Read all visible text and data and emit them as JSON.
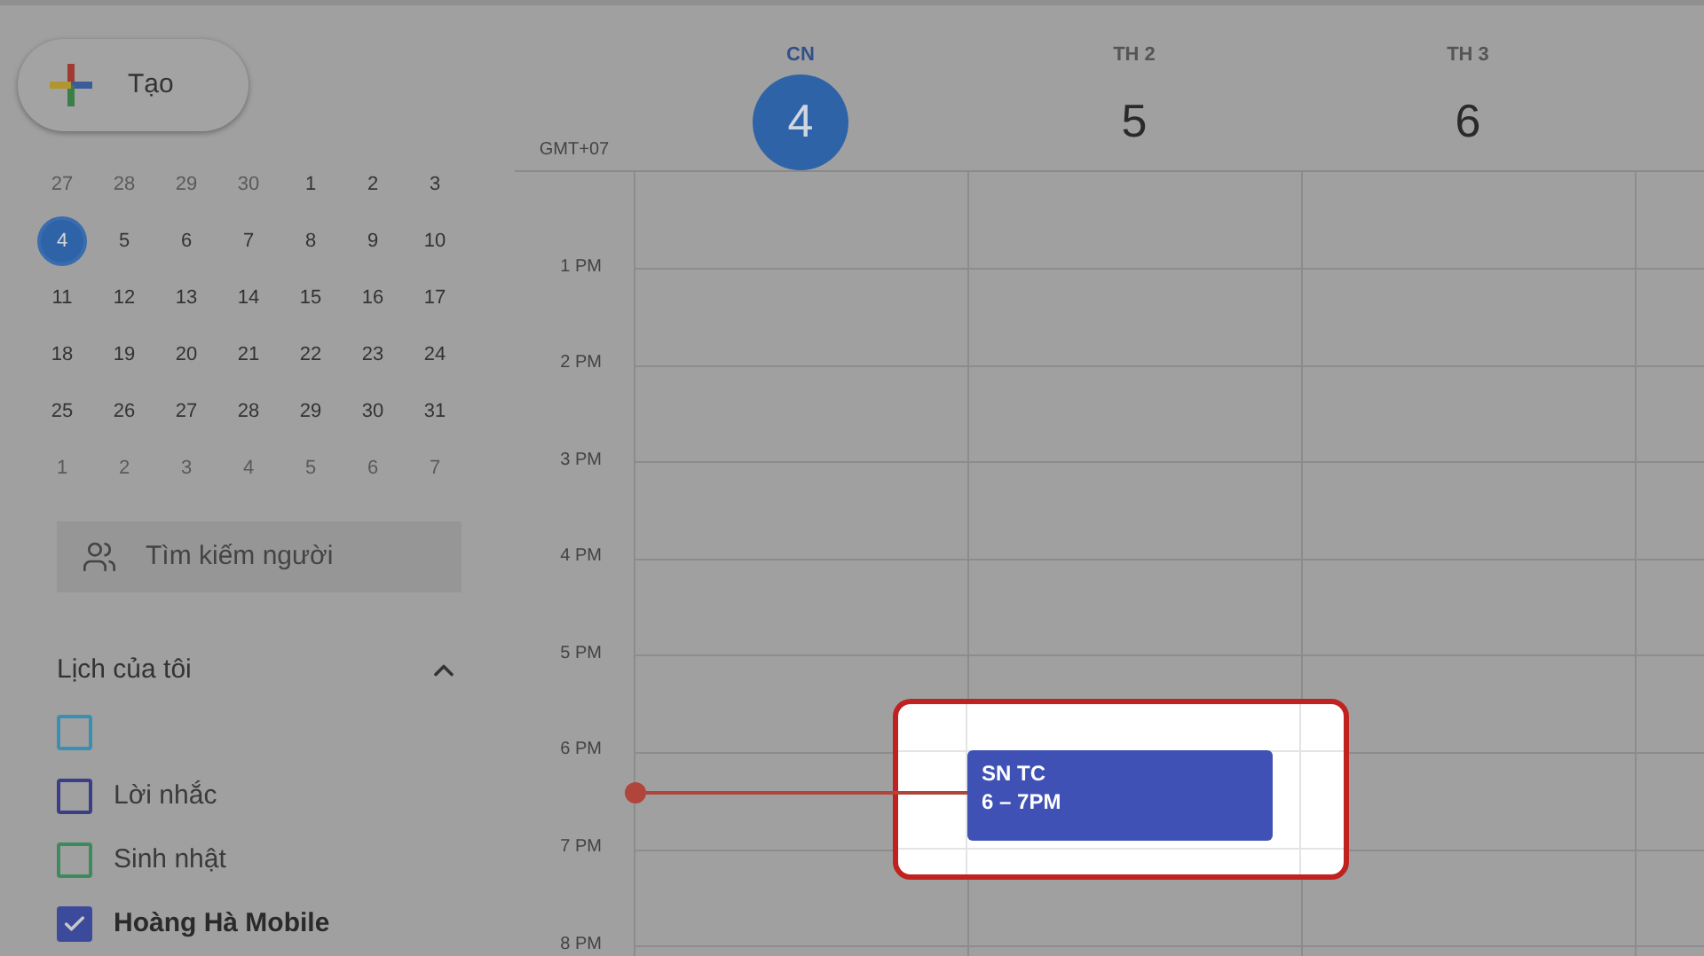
{
  "create_button": {
    "label": "Tạo"
  },
  "mini_calendar": {
    "weeks": [
      [
        {
          "label": "27",
          "outside_month": true,
          "selected": false
        },
        {
          "label": "28",
          "outside_month": true,
          "selected": false
        },
        {
          "label": "29",
          "outside_month": true,
          "selected": false
        },
        {
          "label": "30",
          "outside_month": true,
          "selected": false
        },
        {
          "label": "1",
          "outside_month": false,
          "selected": false
        },
        {
          "label": "2",
          "outside_month": false,
          "selected": false
        },
        {
          "label": "3",
          "outside_month": false,
          "selected": false
        }
      ],
      [
        {
          "label": "4",
          "outside_month": false,
          "selected": true
        },
        {
          "label": "5",
          "outside_month": false,
          "selected": false
        },
        {
          "label": "6",
          "outside_month": false,
          "selected": false
        },
        {
          "label": "7",
          "outside_month": false,
          "selected": false
        },
        {
          "label": "8",
          "outside_month": false,
          "selected": false
        },
        {
          "label": "9",
          "outside_month": false,
          "selected": false
        },
        {
          "label": "10",
          "outside_month": false,
          "selected": false
        }
      ],
      [
        {
          "label": "11",
          "outside_month": false,
          "selected": false
        },
        {
          "label": "12",
          "outside_month": false,
          "selected": false
        },
        {
          "label": "13",
          "outside_month": false,
          "selected": false
        },
        {
          "label": "14",
          "outside_month": false,
          "selected": false
        },
        {
          "label": "15",
          "outside_month": false,
          "selected": false
        },
        {
          "label": "16",
          "outside_month": false,
          "selected": false
        },
        {
          "label": "17",
          "outside_month": false,
          "selected": false
        }
      ],
      [
        {
          "label": "18",
          "outside_month": false,
          "selected": false
        },
        {
          "label": "19",
          "outside_month": false,
          "selected": false
        },
        {
          "label": "20",
          "outside_month": false,
          "selected": false
        },
        {
          "label": "21",
          "outside_month": false,
          "selected": false
        },
        {
          "label": "22",
          "outside_month": false,
          "selected": false
        },
        {
          "label": "23",
          "outside_month": false,
          "selected": false
        },
        {
          "label": "24",
          "outside_month": false,
          "selected": false
        }
      ],
      [
        {
          "label": "25",
          "outside_month": false,
          "selected": false
        },
        {
          "label": "26",
          "outside_month": false,
          "selected": false
        },
        {
          "label": "27",
          "outside_month": false,
          "selected": false
        },
        {
          "label": "28",
          "outside_month": false,
          "selected": false
        },
        {
          "label": "29",
          "outside_month": false,
          "selected": false
        },
        {
          "label": "30",
          "outside_month": false,
          "selected": false
        },
        {
          "label": "31",
          "outside_month": false,
          "selected": false
        }
      ],
      [
        {
          "label": "1",
          "outside_month": true,
          "selected": false
        },
        {
          "label": "2",
          "outside_month": true,
          "selected": false
        },
        {
          "label": "3",
          "outside_month": true,
          "selected": false
        },
        {
          "label": "4",
          "outside_month": true,
          "selected": false
        },
        {
          "label": "5",
          "outside_month": true,
          "selected": false
        },
        {
          "label": "6",
          "outside_month": true,
          "selected": false
        },
        {
          "label": "7",
          "outside_month": true,
          "selected": false
        }
      ]
    ]
  },
  "people_search": {
    "placeholder": "Tìm kiếm người"
  },
  "my_calendars": {
    "title": "Lịch của tôi",
    "expanded": true,
    "items": [
      {
        "color": "#3b8fb0",
        "checked": false
      },
      {
        "label": "Lời nhắc",
        "color": "#3b3e86",
        "checked": false
      },
      {
        "label": "Sinh nhật",
        "color": "#3c8a5e",
        "checked": false
      },
      {
        "label": "Hoàng Hà Mobile",
        "color": "#3c4a9c",
        "checked": true
      }
    ]
  },
  "timezone": "GMT+07",
  "days": [
    {
      "name": "CN",
      "date": "4",
      "selected": true
    },
    {
      "name": "TH 2",
      "date": "5",
      "selected": false
    },
    {
      "name": "TH 3",
      "date": "6",
      "selected": false
    }
  ],
  "hours": [
    "1 PM",
    "2 PM",
    "3 PM",
    "4 PM",
    "5 PM",
    "6 PM",
    "7 PM",
    "8 PM"
  ],
  "event": {
    "title": "SN TC",
    "time": "6 – 7PM"
  }
}
